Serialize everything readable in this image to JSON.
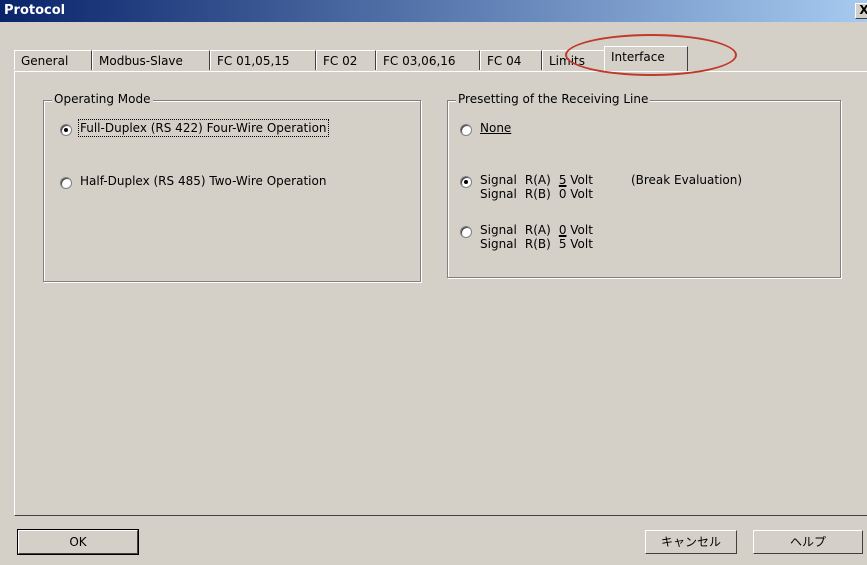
{
  "window": {
    "title": "Protocol",
    "close_glyph": "X"
  },
  "tabs": [
    {
      "label": "General"
    },
    {
      "label": "Modbus-Slave"
    },
    {
      "label": "FC 01,05,15"
    },
    {
      "label": "FC 02"
    },
    {
      "label": "FC 03,06,16"
    },
    {
      "label": "FC 04"
    },
    {
      "label": "Limits"
    },
    {
      "label": "Interface",
      "active": true
    }
  ],
  "operating_mode": {
    "title": "Operating Mode",
    "options": [
      {
        "label": "Full-Duplex (RS 422) Four-Wire Operation",
        "mnemonic": "F",
        "checked": true
      },
      {
        "label": "Half-Duplex (RS 485) Two-Wire Operation",
        "mnemonic": "H",
        "checked": false
      }
    ]
  },
  "receiving_line": {
    "title": "Presetting of the Receiving Line",
    "none_label": "None",
    "option_signal_5": {
      "row1": {
        "signal": "Signal",
        "line": "R(A)",
        "value": "5",
        "unit": "Volt"
      },
      "row2": {
        "signal": "Signal",
        "line": "R(B)",
        "value": "0",
        "unit": "Volt"
      },
      "note": "(Break Evaluation)",
      "checked": true
    },
    "option_signal_0": {
      "row1": {
        "signal": "Signal",
        "line": "R(A)",
        "value": "0",
        "unit": "Volt"
      },
      "row2": {
        "signal": "Signal",
        "line": "R(B)",
        "value": "5",
        "unit": "Volt"
      },
      "checked": false
    }
  },
  "buttons": {
    "ok": "OK",
    "cancel": "キャンセル",
    "help": "ヘルプ"
  },
  "colors": {
    "dialog_bg": "#d4d0c8",
    "title_start": "#0a246a",
    "title_end": "#a6caf0",
    "annotation": "#c0392b"
  }
}
